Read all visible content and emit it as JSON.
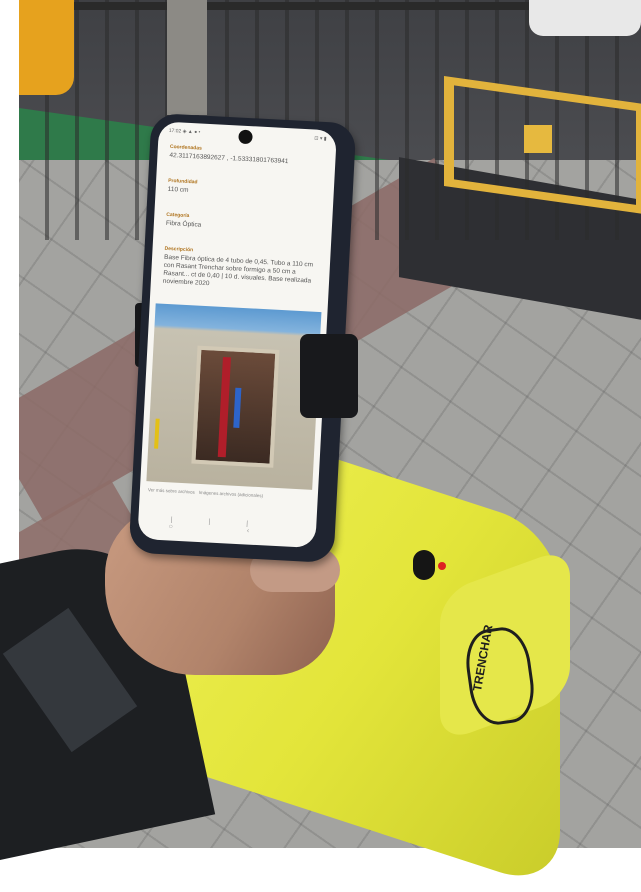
{
  "phone_app": {
    "status_time": "17:02",
    "status_icons": "◈ ▲ ● •",
    "status_right": "⊡ ▾ ▮",
    "fields": [
      {
        "label": "Coordenadas",
        "value": "42.3117163892627 , -1.53331801763941"
      },
      {
        "label": "Profundidad",
        "value": "110 cm"
      },
      {
        "label": "Categoría",
        "value": "Fibra Óptica"
      },
      {
        "label": "Descripción",
        "value": "Base Fibra óptica de 4 tubo de 0,45. Tubo a 110 cm con Rasant Trenchar sobre formigo a 50 cm a Rasant... ct de 0,40 | 10 d. visuales. Base realizada noviembre 2020"
      }
    ],
    "links": [
      "Ver más sobre archivos",
      "Imágenes archivos (adicionales)"
    ],
    "photo_caption_hint": "",
    "navbar": "||| ○ ‹"
  },
  "device": {
    "logo_text": "TRENCHAR"
  }
}
